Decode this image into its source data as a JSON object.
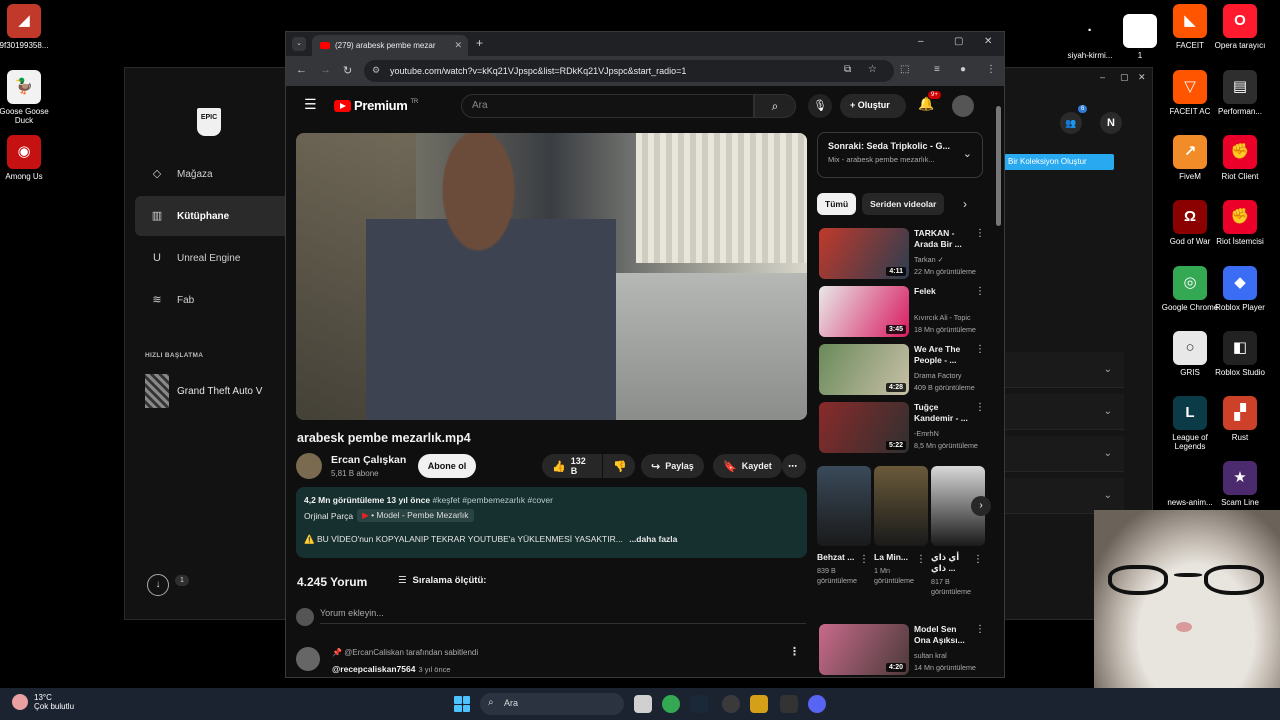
{
  "desktop_icons_left": [
    {
      "label": "9f30199358...",
      "color": "#c0392b",
      "glyph": "◢"
    },
    {
      "label": "Goose Goose Duck",
      "color": "#f2f2f2",
      "glyph": "🦆"
    },
    {
      "label": "Among Us",
      "color": "#c51111",
      "glyph": "◉"
    }
  ],
  "desktop_icons_right": [
    {
      "label": "siyah-kirmi...",
      "color": "#000000",
      "glyph": "·"
    },
    {
      "label": "1",
      "color": "#ffffff",
      "glyph": ""
    },
    {
      "label": "FACEIT",
      "color": "#ff5500",
      "glyph": "◣"
    },
    {
      "label": "Opera tarayıcı",
      "color": "#ff1b2d",
      "glyph": "O"
    },
    {
      "label": "FACEIT AC",
      "color": "#ff5500",
      "glyph": "▽"
    },
    {
      "label": "Performan...",
      "color": "#2e2e2e",
      "glyph": "▤"
    },
    {
      "label": "FiveM",
      "color": "#f28c28",
      "glyph": "↗"
    },
    {
      "label": "Riot Client",
      "color": "#eb0029",
      "glyph": "✊"
    },
    {
      "label": "God of War",
      "color": "#8b0000",
      "glyph": "Ω"
    },
    {
      "label": "Riot İstemcisi",
      "color": "#eb0029",
      "glyph": "✊"
    },
    {
      "label": "Google Chrome",
      "color": "#34a853",
      "glyph": "◎"
    },
    {
      "label": "Roblox Player",
      "color": "#3a6cf4",
      "glyph": "◆"
    },
    {
      "label": "GRIS",
      "color": "#e8e8e8",
      "glyph": "○"
    },
    {
      "label": "Roblox Studio",
      "color": "#222222",
      "glyph": "◧"
    },
    {
      "label": "League of Legends",
      "color": "#0a3b46",
      "glyph": "L"
    },
    {
      "label": "Rust",
      "color": "#cd412b",
      "glyph": "▞"
    },
    {
      "label": "news-anim...",
      "color": "#000000",
      "glyph": ""
    },
    {
      "label": "Scam Line",
      "color": "#4b2a6e",
      "glyph": "★"
    }
  ],
  "epic": {
    "logo": "EPIC",
    "nav": [
      {
        "label": "Mağaza",
        "icon": "◇"
      },
      {
        "label": "Kütüphane",
        "icon": "▥"
      },
      {
        "label": "Unreal Engine",
        "icon": "U"
      },
      {
        "label": "Fab",
        "icon": "≋"
      }
    ],
    "quick_start": "HIZLI BAŞLATMA",
    "quick_game": "Grand Theft Auto V",
    "downloads_count": "1"
  },
  "bgapp": {
    "button": "Bir Koleksiyon Oluştur",
    "avatar": "N",
    "friends_badge": "6"
  },
  "browser": {
    "tab_title": "(279) arabesk pembe mezar",
    "url": "youtube.com/watch?v=kKq21VJpspc&list=RDkKq21VJpspc&start_radio=1"
  },
  "yt": {
    "logo": "Premium",
    "logo_sup": "TR",
    "search_placeholder": "Ara",
    "create_label": "Oluştur",
    "bell_count": "9+",
    "video_title": "arabesk pembe mezarlık.mp4",
    "channel_name": "Ercan Çalışkan",
    "channel_subs": "5,81 B abone",
    "subscribe": "Abone ol",
    "likes": "132 B",
    "share": "Paylaş",
    "save": "Kaydet",
    "desc_views": "4,2 Mn görüntüleme  13 yıl önce",
    "desc_tags": "#keşfet #pembemezarlık #cover",
    "desc_original": "Orjinal Parça",
    "desc_chip": "• Model - Pembe Mezarlık",
    "desc_line": "⚠️ BU VİDEO'nun KOPYALANIP TEKRAR YOUTUBE'a YÜKLENMESİ YASAKTIR...",
    "desc_more": "...daha fazla",
    "comment_count": "4.245 Yorum",
    "sort_label": "Sıralama ölçütü:",
    "comment_placeholder": "Yorum ekleyin...",
    "pinned_by": "@ErcanCaliskan tarafından sabitlendi",
    "pinned_user": "@recepcaliskan7564",
    "pinned_time": "3 yıl önce",
    "next_title": "Sonraki: Seda Tripkolic - G...",
    "next_sub": "Mix - arabesk pembe mezarlık...",
    "chips": [
      "Tümü",
      "Seriden videolar"
    ],
    "recs": [
      {
        "title": "TARKAN - Arada Bir ...",
        "channel": "Tarkan ✓",
        "views": "22 Mn görüntüleme",
        "dur": "4:11",
        "c1": "#c0392b",
        "c2": "#2c3e50"
      },
      {
        "title": "Felek",
        "channel": "Kıvırcık Ali - Topic",
        "views": "18 Mn görüntüleme",
        "dur": "3:45",
        "c1": "#e8e8e8",
        "c2": "#d81b60"
      },
      {
        "title": "We Are The People - ...",
        "channel": "Drama Factory",
        "views": "409 B görüntüleme",
        "dur": "4:28",
        "c1": "#6a8a5a",
        "c2": "#c8c0a8"
      },
      {
        "title": "Tuğçe Kandemir - ...",
        "channel": "-EmrhN",
        "views": "8,5 Mn görüntüleme",
        "dur": "5:22",
        "c1": "#8a2a2a",
        "c2": "#303030"
      },
      {
        "title": "Model Sen Ona Aşıksı...",
        "channel": "sultan kral",
        "views": "14 Mn görüntüleme",
        "dur": "4:20",
        "c1": "#c86a8a",
        "c2": "#4a3a3a"
      }
    ],
    "shorts": [
      {
        "title": "Behzat ...",
        "views": "839 B görüntüleme",
        "color": "#3a4a5a"
      },
      {
        "title": "La Min...",
        "views": "1 Mn görüntüleme",
        "color": "#6a5a3a"
      },
      {
        "title": "أي ذاي ذاي ...",
        "views": "817 B görüntüleme",
        "color": "#d8d8d8"
      }
    ]
  },
  "taskbar": {
    "temp": "13°C",
    "weather": "Çok bulutlu",
    "search": "Ara"
  }
}
